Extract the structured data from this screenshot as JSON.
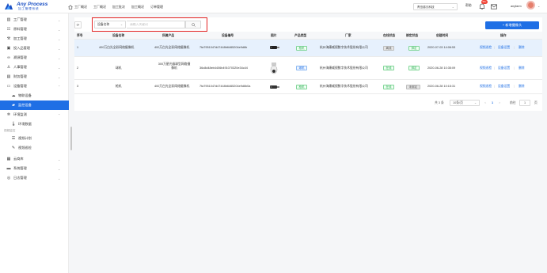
{
  "header": {
    "logo_title": "Any Process",
    "logo_subtitle": "加工管理系统",
    "nav": [
      {
        "label": "工厂概况",
        "icon": "home-icon"
      },
      {
        "label": "工厂概况"
      },
      {
        "label": "加工批次"
      },
      {
        "label": "加工概况"
      },
      {
        "label": "订单管理"
      }
    ],
    "org_select": "青岛感沉科技",
    "help": "帮助",
    "notification_count": "99+",
    "username": "anyfarm"
  },
  "sidebar": {
    "items": [
      {
        "label": "工厂管理",
        "icon": "factory-icon",
        "has_chevron": true
      },
      {
        "label": "原料管理",
        "icon": "material-icon",
        "has_chevron": true
      },
      {
        "label": "加工管理",
        "icon": "hammer-icon",
        "has_chevron": true
      },
      {
        "label": "投入品管理",
        "icon": "input-icon",
        "has_chevron": true
      },
      {
        "label": "溯源管理",
        "icon": "trace-icon",
        "has_chevron": true
      },
      {
        "label": "人事管理",
        "icon": "person-icon",
        "has_chevron": true
      },
      {
        "label": "财务管理",
        "icon": "finance-icon",
        "has_chevron": true
      },
      {
        "label": "设备管理",
        "icon": "device-icon",
        "has_chevron": true
      },
      {
        "label": "物联设备",
        "icon": "cloud-icon",
        "sub": true
      },
      {
        "label": "监控设备",
        "icon": "camera-icon",
        "sub": true,
        "active": true
      },
      {
        "label": "环境监测",
        "icon": "gear-icon",
        "has_chevron": true
      },
      {
        "label": "环境数据",
        "icon": "thermometer-icon",
        "sub": true
      },
      {
        "group": "视频监控"
      },
      {
        "label": "视频计划",
        "icon": "list-icon",
        "sub": true
      },
      {
        "label": "视频巡检",
        "icon": "inspect-icon",
        "sub": true
      },
      {
        "label": "云商库",
        "icon": "store-icon",
        "has_chevron": true
      },
      {
        "label": "系统管理",
        "icon": "system-icon",
        "has_chevron": true
      },
      {
        "label": "日志管理",
        "icon": "log-icon",
        "has_chevron": true
      }
    ]
  },
  "toolbar": {
    "field_select": "设备名称",
    "search_placeholder": "请输入关键词",
    "add_button": "+ 新增摄像头"
  },
  "table": {
    "columns": [
      "序号",
      "设备名称",
      "所属产品",
      "设备编号",
      "图片",
      "产品类型",
      "厂家",
      "在线状态",
      "绑定状态",
      "创建时间",
      "操作"
    ],
    "rows": [
      {
        "index": "1",
        "name": "400万白光全彩网络摄像机",
        "product": "400万白光全彩网络摄像机",
        "code": "7fa7951047d47448b6465204e9d6b",
        "product_type": "枪机",
        "vendor": "杭州海康威视数字技术股份有限公司",
        "online": "离线",
        "bind": "绑定",
        "created": "2020-07-03 14:06:53",
        "actions": [
          "视频巡检",
          "设备设置",
          "删除"
        ],
        "selected": true
      },
      {
        "index": "2",
        "name": "球机",
        "product": "300万星光级球型网络摄像机",
        "code": "36c8d48eb4406b491070320e34c44",
        "product_type": "球机",
        "vendor": "杭州海康威视数字技术股份有限公司",
        "online": "在线",
        "bind": "绑定",
        "created": "2020-06-28 10:35:09",
        "actions": [
          "视频巡检",
          "设备设置",
          "删除"
        ]
      },
      {
        "index": "3",
        "name": "枪机",
        "product": "400万白光全彩网络摄像机",
        "code": "7fa7951047d47448b6465204e9d6b0a",
        "product_type": "枪机",
        "vendor": "杭州海康威视数字技术股份有限公司",
        "online": "在线",
        "bind": "未绑定",
        "created": "2020-06-28 10:15:31",
        "actions": [
          "视频巡检",
          "设备设置",
          "删除"
        ]
      }
    ]
  },
  "pagination": {
    "total": "共 3 条",
    "page_size": "10条/页",
    "prev": "<",
    "current_page": "1",
    "next": ">",
    "goto_label": "前往",
    "goto_value": "1",
    "page_suffix": "页"
  }
}
